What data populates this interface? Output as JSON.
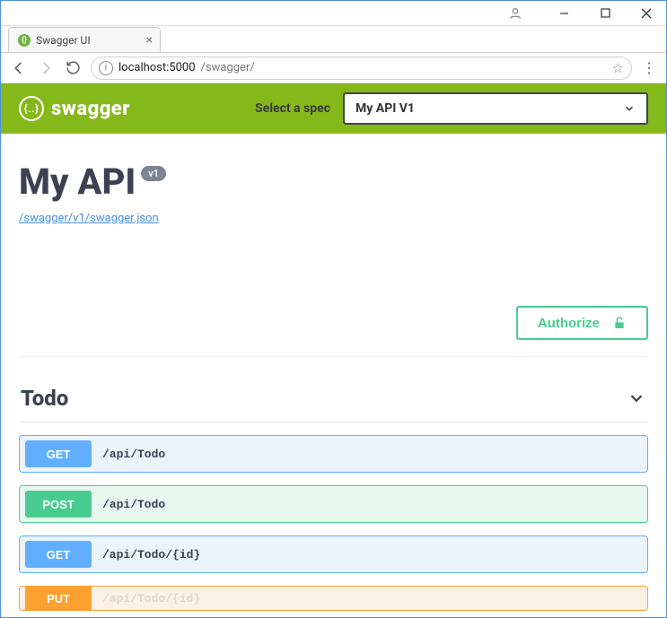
{
  "browser": {
    "tab_title": "Swagger UI",
    "url_host": "localhost",
    "url_port": ":5000",
    "url_path": "/swagger/"
  },
  "header": {
    "brand": "swagger",
    "select_label": "Select a spec",
    "selected_spec": "My API V1"
  },
  "info": {
    "title": "My API",
    "version": "v1",
    "definition_link": "/swagger/v1/swagger.json"
  },
  "auth": {
    "authorize_label": "Authorize"
  },
  "tag": {
    "name": "Todo"
  },
  "operations": [
    {
      "method": "GET",
      "path": "/api/Todo",
      "style": "get"
    },
    {
      "method": "POST",
      "path": "/api/Todo",
      "style": "post"
    },
    {
      "method": "GET",
      "path": "/api/Todo/{id}",
      "style": "get"
    },
    {
      "method": "PUT",
      "path": "/api/Todo/{id}",
      "style": "put"
    }
  ]
}
